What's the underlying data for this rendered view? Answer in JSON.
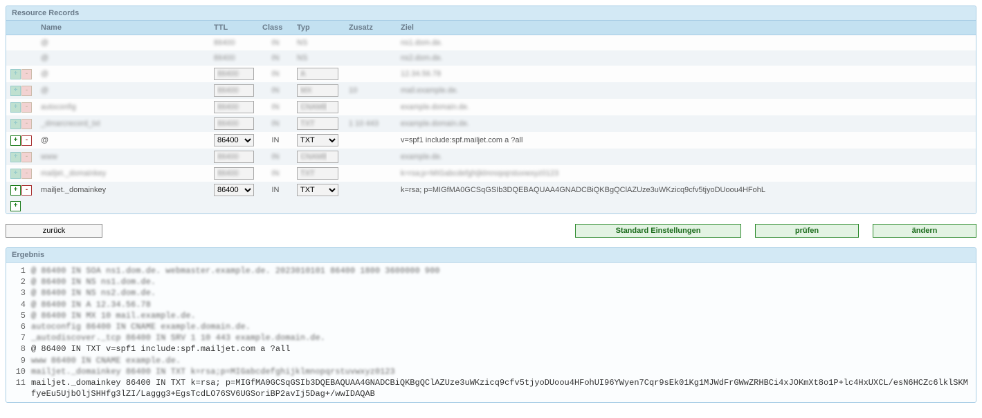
{
  "panel1_title": "Resource Records",
  "columns": {
    "name": "Name",
    "ttl": "TTL",
    "class": "Class",
    "typ": "Typ",
    "zusatz": "Zusatz",
    "ziel": "Ziel"
  },
  "rows": [
    {
      "mode": "static",
      "alt": false,
      "name": "@",
      "ttl": "86400",
      "cls": "IN",
      "typ": "NS",
      "zus": "",
      "ziel": "ns1.dom.de.",
      "blur": true
    },
    {
      "mode": "static",
      "alt": true,
      "name": "@",
      "ttl": "86400",
      "cls": "IN",
      "typ": "NS",
      "zus": "",
      "ziel": "ns2.dom.de.",
      "blur": true
    },
    {
      "mode": "edit",
      "alt": false,
      "muted": true,
      "name": "@",
      "ttl": "86400",
      "cls": "IN",
      "typ": "A",
      "zus": "",
      "ziel": "12.34.56.78",
      "blur": true
    },
    {
      "mode": "edit",
      "alt": true,
      "muted": true,
      "name": "@",
      "ttl": "86400",
      "cls": "IN",
      "typ": "MX",
      "zus": "10",
      "ziel": "mail.example.de.",
      "blur": true
    },
    {
      "mode": "edit",
      "alt": false,
      "muted": true,
      "name": "autoconfig",
      "ttl": "86400",
      "cls": "IN",
      "typ": "CNAME",
      "zus": "",
      "ziel": "example.domain.de.",
      "blur": true
    },
    {
      "mode": "edit",
      "alt": true,
      "muted": true,
      "name": "_dmarcrecord_txt",
      "ttl": "86400",
      "cls": "IN",
      "typ": "TXT",
      "zus": "1 10 443",
      "ziel": "example.domain.de.",
      "blur": true
    },
    {
      "mode": "edit",
      "alt": false,
      "name": "@",
      "ttl": "86400",
      "cls": "IN",
      "typ": "TXT",
      "zus": "",
      "ziel": "v=spf1 include:spf.mailjet.com a ?all",
      "blur": false
    },
    {
      "mode": "edit",
      "alt": true,
      "muted": true,
      "name": "www",
      "ttl": "86400",
      "cls": "IN",
      "typ": "CNAME",
      "zus": "",
      "ziel": "example.de.",
      "blur": true
    },
    {
      "mode": "edit",
      "alt": false,
      "muted": true,
      "name": "mailjet._domainkey",
      "ttl": "86400",
      "cls": "IN",
      "typ": "TXT",
      "zus": "",
      "ziel": "k=rsa;p=MIGabcdefghijklmnopqrstuvwxyz0123",
      "blur": true
    },
    {
      "mode": "edit",
      "alt": true,
      "name": "mailjet._domainkey",
      "ttl": "86400",
      "cls": "IN",
      "typ": "TXT",
      "zus": "",
      "ziel": "k=rsa; p=MIGfMA0GCSqGSIb3DQEBAQUAA4GNADCBiQKBgQClAZUze3uWKzicq9cfv5tjyoDUoou4HFohL",
      "blur": false
    }
  ],
  "buttons": {
    "back": "zurück",
    "standard": "Standard Einstellungen",
    "check": "prüfen",
    "change": "ändern"
  },
  "panel2_title": "Ergebnis",
  "result_lines": [
    {
      "n": 1,
      "blur": true,
      "text": "@ 86400 IN SOA ns1.dom.de. webmaster.example.de. 2023010101 86400 1800 3600000 900"
    },
    {
      "n": 2,
      "blur": true,
      "text": "@ 86400 IN NS ns1.dom.de."
    },
    {
      "n": 3,
      "blur": true,
      "text": "@ 86400 IN NS ns2.dom.de."
    },
    {
      "n": 4,
      "blur": true,
      "text": "@ 86400 IN A 12.34.56.78"
    },
    {
      "n": 5,
      "blur": true,
      "text": "@ 86400 IN MX 10 mail.example.de."
    },
    {
      "n": 6,
      "blur": true,
      "text": "autoconfig 86400 IN CNAME example.domain.de."
    },
    {
      "n": 7,
      "blur": true,
      "text": "_autodiscover._tcp 86400 IN SRV 1 10 443 example.domain.de."
    },
    {
      "n": 8,
      "blur": false,
      "text": "@ 86400 IN TXT v=spf1 include:spf.mailjet.com a ?all"
    },
    {
      "n": 9,
      "blur": true,
      "text": "www 86400 IN CNAME example.de."
    },
    {
      "n": 10,
      "blur": true,
      "text": "mailjet._domainkey 86400 IN TXT k=rsa;p=MIGabcdefghijklmnopqrstuvwxyz0123"
    },
    {
      "n": 11,
      "blur": false,
      "text": "mailjet._domainkey 86400 IN TXT k=rsa; p=MIGfMA0GCSqGSIb3DQEBAQUAA4GNADCBiQKBgQClAZUze3uWKzicq9cfv5tjyoDUoou4HFohUI96YWyen7Cqr9sEk01Kg1MJWdFrGWwZRHBCi4xJOKmXt8o1P+lc4HxUXCL/esN6HCZc6lklSKMfyeEu5UjbOljSHHfg3lZI/Laggg3+EgsTcdLO76SV6UGSoriBP2avIj5Dag+/wwIDAQAB"
    }
  ]
}
